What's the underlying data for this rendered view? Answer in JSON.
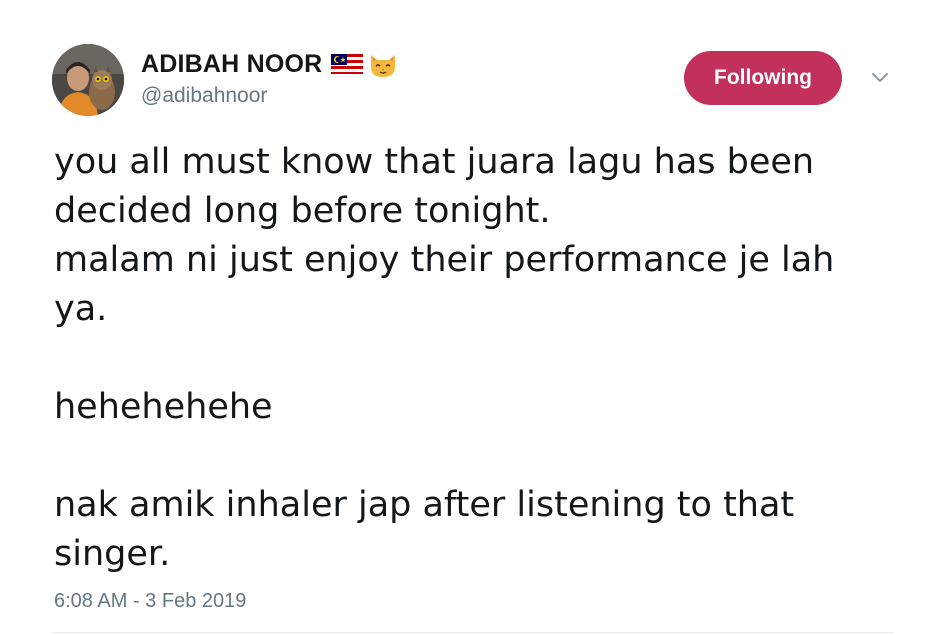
{
  "user": {
    "display_name": "ADIBAH NOOR",
    "handle": "@adibahnoor",
    "name_emojis": [
      "malaysia-flag-icon",
      "cat-face-icon"
    ]
  },
  "follow_button": {
    "label": "Following",
    "color": "#c2305c"
  },
  "tweet": {
    "lines": [
      "you all must know that juara lagu has been",
      "decided long before tonight.",
      "malam ni just enjoy their performance je lah",
      "ya.",
      "",
      "hehehehehe",
      "",
      "nak amik inhaler jap after listening to that",
      "singer."
    ],
    "time": "6:08 AM",
    "separator": " - ",
    "date": "3 Feb 2019"
  },
  "colors": {
    "text": "#14171a",
    "muted": "#657786",
    "divider": "#e6ecf0"
  }
}
